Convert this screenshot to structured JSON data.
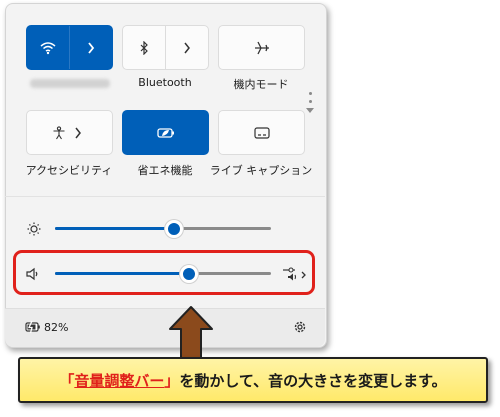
{
  "quick_settings": {
    "tiles": [
      {
        "id": "wifi",
        "label": "",
        "active": true,
        "icon": "wifi-icon",
        "has_chevron": true
      },
      {
        "id": "bluetooth",
        "label": "Bluetooth",
        "active": false,
        "icon": "bluetooth-icon",
        "has_chevron": true
      },
      {
        "id": "airplane",
        "label": "機内モード",
        "active": false,
        "icon": "airplane-icon",
        "has_chevron": false
      },
      {
        "id": "accessibility",
        "label": "アクセシビリティ",
        "active": false,
        "icon": "accessibility-icon",
        "has_chevron": true
      },
      {
        "id": "battery_saver",
        "label": "省エネ機能",
        "active": true,
        "icon": "battery-saver-icon",
        "has_chevron": false
      },
      {
        "id": "live_captions",
        "label": "ライブ キャプション",
        "active": false,
        "icon": "captions-icon",
        "has_chevron": false
      }
    ]
  },
  "sliders": {
    "brightness": {
      "icon": "sun-icon",
      "level": 0.55
    },
    "volume": {
      "icon": "speaker-icon",
      "level": 0.62,
      "output_icon": "audio-output-icon"
    }
  },
  "footer": {
    "battery_percent": "82%",
    "battery_icon": "battery-charging-icon",
    "settings_icon": "gear-icon"
  },
  "callout": {
    "open_bracket": "「",
    "highlight": "音量調整バー",
    "close_bracket": "」",
    "text": "を動かして、音の大きさを変更します。"
  },
  "colors": {
    "accent": "#005fb8",
    "highlight_border": "#e0211b",
    "callout_bg": "#ffe96a",
    "arrow": "#8b4a1c"
  }
}
